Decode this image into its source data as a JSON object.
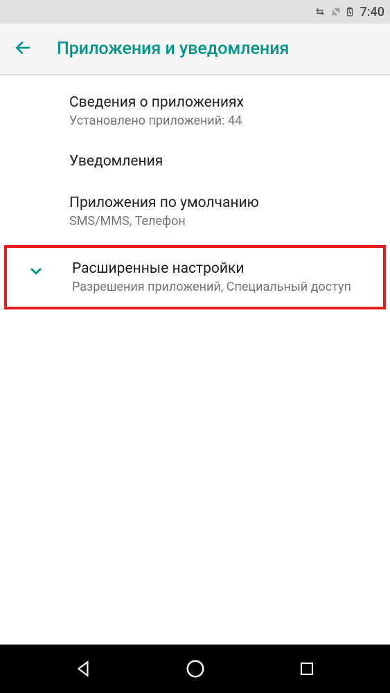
{
  "status": {
    "time": "7:40"
  },
  "header": {
    "title": "Приложения и уведомления"
  },
  "items": [
    {
      "title": "Сведения о приложениях",
      "subtitle": "Установлено приложений: 44"
    },
    {
      "title": "Уведомления",
      "subtitle": null
    },
    {
      "title": "Приложения по умолчанию",
      "subtitle": "SMS/MMS, Телефон"
    },
    {
      "title": "Расширенные настройки",
      "subtitle": "Разрешения приложений, Специальный доступ"
    }
  ],
  "colors": {
    "accent": "#009688",
    "highlight_border": "#e31e1e",
    "text_primary": "#212121",
    "text_secondary": "#757575"
  }
}
